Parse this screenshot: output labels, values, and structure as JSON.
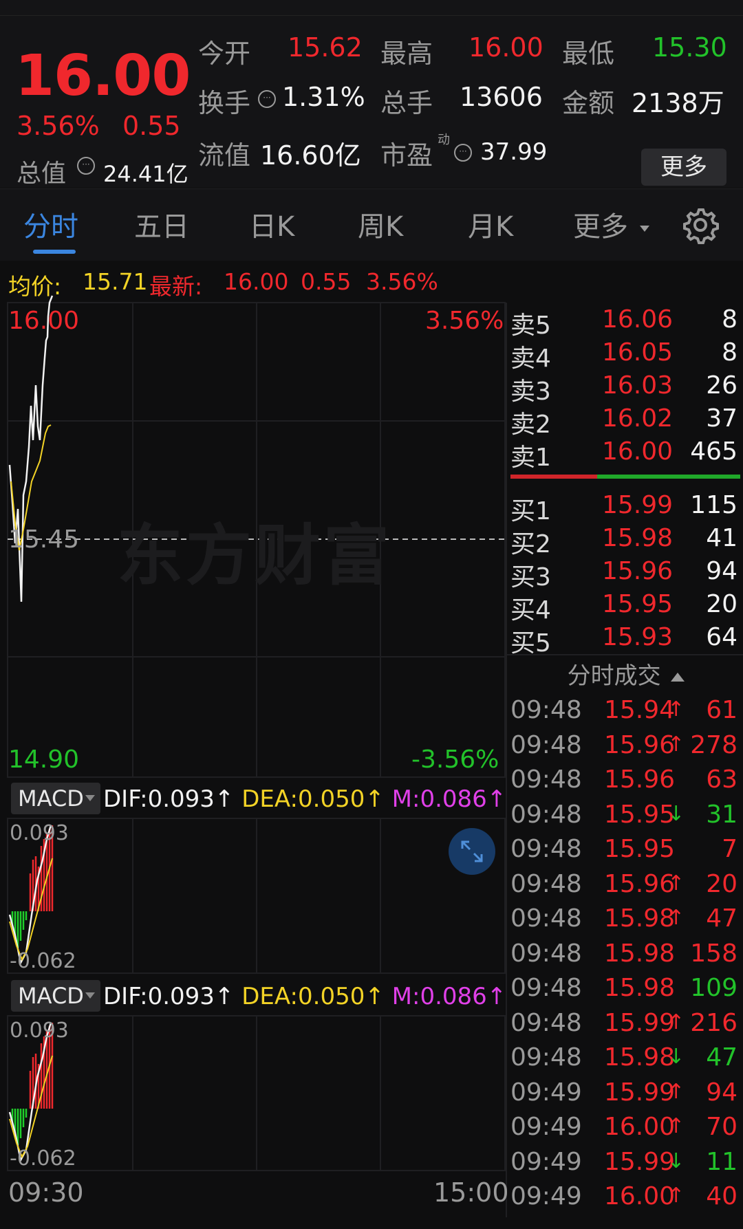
{
  "quote": {
    "price": "16.00",
    "change_pct": "3.56%",
    "change": "0.55",
    "total_value_label": "总值",
    "total_value": "24.41亿",
    "open_label": "今开",
    "open": "15.62",
    "high_label": "最高",
    "high": "16.00",
    "low_label": "最低",
    "low": "15.30",
    "turnover_label": "换手",
    "turnover": "1.31%",
    "volume_label": "总手",
    "volume": "13606",
    "amount_label": "金额",
    "amount": "2138万",
    "float_value_label": "流值",
    "float_value": "16.60亿",
    "pe_label": "市盈",
    "pe_superscript": "动",
    "pe": "37.99",
    "more_button": "更多"
  },
  "tabs": [
    {
      "label": "分时",
      "active": true
    },
    {
      "label": "五日",
      "active": false
    },
    {
      "label": "日K",
      "active": false
    },
    {
      "label": "周K",
      "active": false
    },
    {
      "label": "月K",
      "active": false
    },
    {
      "label": "更多",
      "active": false
    }
  ],
  "settings_icon": "gear-icon",
  "avg_bar": {
    "avg_label": "均价:",
    "avg": "15.71",
    "latest_label": "最新:",
    "latest": "16.00",
    "latest_change": "0.55",
    "latest_pct": "3.56%"
  },
  "price_chart": {
    "top_price": "16.00",
    "top_pct": "3.56%",
    "mid_price": "15.45",
    "bottom_price": "14.90",
    "bottom_pct": "-3.56%",
    "watermark": "东方财富",
    "time_start": "09:30",
    "time_end": "15:00"
  },
  "macd": [
    {
      "selector": "MACD",
      "dif_label": "DIF:",
      "dif": "0.093↑",
      "dea_label": "DEA:",
      "dea": "0.050↑",
      "m_label": "M:",
      "m": "0.086↑",
      "top": "0.093",
      "bottom": "-0.062"
    },
    {
      "selector": "MACD",
      "dif_label": "DIF:",
      "dif": "0.093↑",
      "dea_label": "DEA:",
      "dea": "0.050↑",
      "m_label": "M:",
      "m": "0.086↑",
      "top": "0.093",
      "bottom": "-0.062"
    }
  ],
  "orderbook": {
    "asks": [
      {
        "label": "卖5",
        "price": "16.06",
        "volume": "8"
      },
      {
        "label": "卖4",
        "price": "16.05",
        "volume": "8"
      },
      {
        "label": "卖3",
        "price": "16.03",
        "volume": "26"
      },
      {
        "label": "卖2",
        "price": "16.02",
        "volume": "37"
      },
      {
        "label": "卖1",
        "price": "16.00",
        "volume": "465"
      }
    ],
    "bids": [
      {
        "label": "买1",
        "price": "15.99",
        "volume": "115"
      },
      {
        "label": "买2",
        "price": "15.98",
        "volume": "41"
      },
      {
        "label": "买3",
        "price": "15.96",
        "volume": "94"
      },
      {
        "label": "买4",
        "price": "15.95",
        "volume": "20"
      },
      {
        "label": "买5",
        "price": "15.93",
        "volume": "64"
      }
    ]
  },
  "ticks_header": "分时成交",
  "ticks": [
    {
      "time": "09:48",
      "price": "15.94",
      "arrow": "↑",
      "volume": "61",
      "color": "#f0282d"
    },
    {
      "time": "09:48",
      "price": "15.96",
      "arrow": "↑",
      "volume": "278",
      "color": "#f0282d"
    },
    {
      "time": "09:48",
      "price": "15.96",
      "arrow": "",
      "volume": "63",
      "color": "#f0282d"
    },
    {
      "time": "09:48",
      "price": "15.95",
      "arrow": "↓",
      "volume": "31",
      "color": "#22c22a"
    },
    {
      "time": "09:48",
      "price": "15.95",
      "arrow": "",
      "volume": "7",
      "color": "#f0282d"
    },
    {
      "time": "09:48",
      "price": "15.96",
      "arrow": "↑",
      "volume": "20",
      "color": "#f0282d"
    },
    {
      "time": "09:48",
      "price": "15.98",
      "arrow": "↑",
      "volume": "47",
      "color": "#f0282d"
    },
    {
      "time": "09:48",
      "price": "15.98",
      "arrow": "",
      "volume": "158",
      "color": "#f0282d"
    },
    {
      "time": "09:48",
      "price": "15.98",
      "arrow": "",
      "volume": "109",
      "color": "#22c22a"
    },
    {
      "time": "09:48",
      "price": "15.99",
      "arrow": "↑",
      "volume": "216",
      "color": "#f0282d"
    },
    {
      "time": "09:48",
      "price": "15.98",
      "arrow": "↓",
      "volume": "47",
      "color": "#22c22a"
    },
    {
      "time": "09:49",
      "price": "15.99",
      "arrow": "↑",
      "volume": "94",
      "color": "#f0282d"
    },
    {
      "time": "09:49",
      "price": "16.00",
      "arrow": "↑",
      "volume": "70",
      "color": "#f0282d"
    },
    {
      "time": "09:49",
      "price": "15.99",
      "arrow": "↓",
      "volume": "11",
      "color": "#22c22a"
    },
    {
      "time": "09:49",
      "price": "16.00",
      "arrow": "↑",
      "volume": "40",
      "color": "#f0282d"
    }
  ],
  "colors": {
    "up": "#f0282d",
    "down": "#22c22a",
    "accent": "#3b86e0",
    "dea": "#f3d326",
    "m": "#e040e8"
  }
}
